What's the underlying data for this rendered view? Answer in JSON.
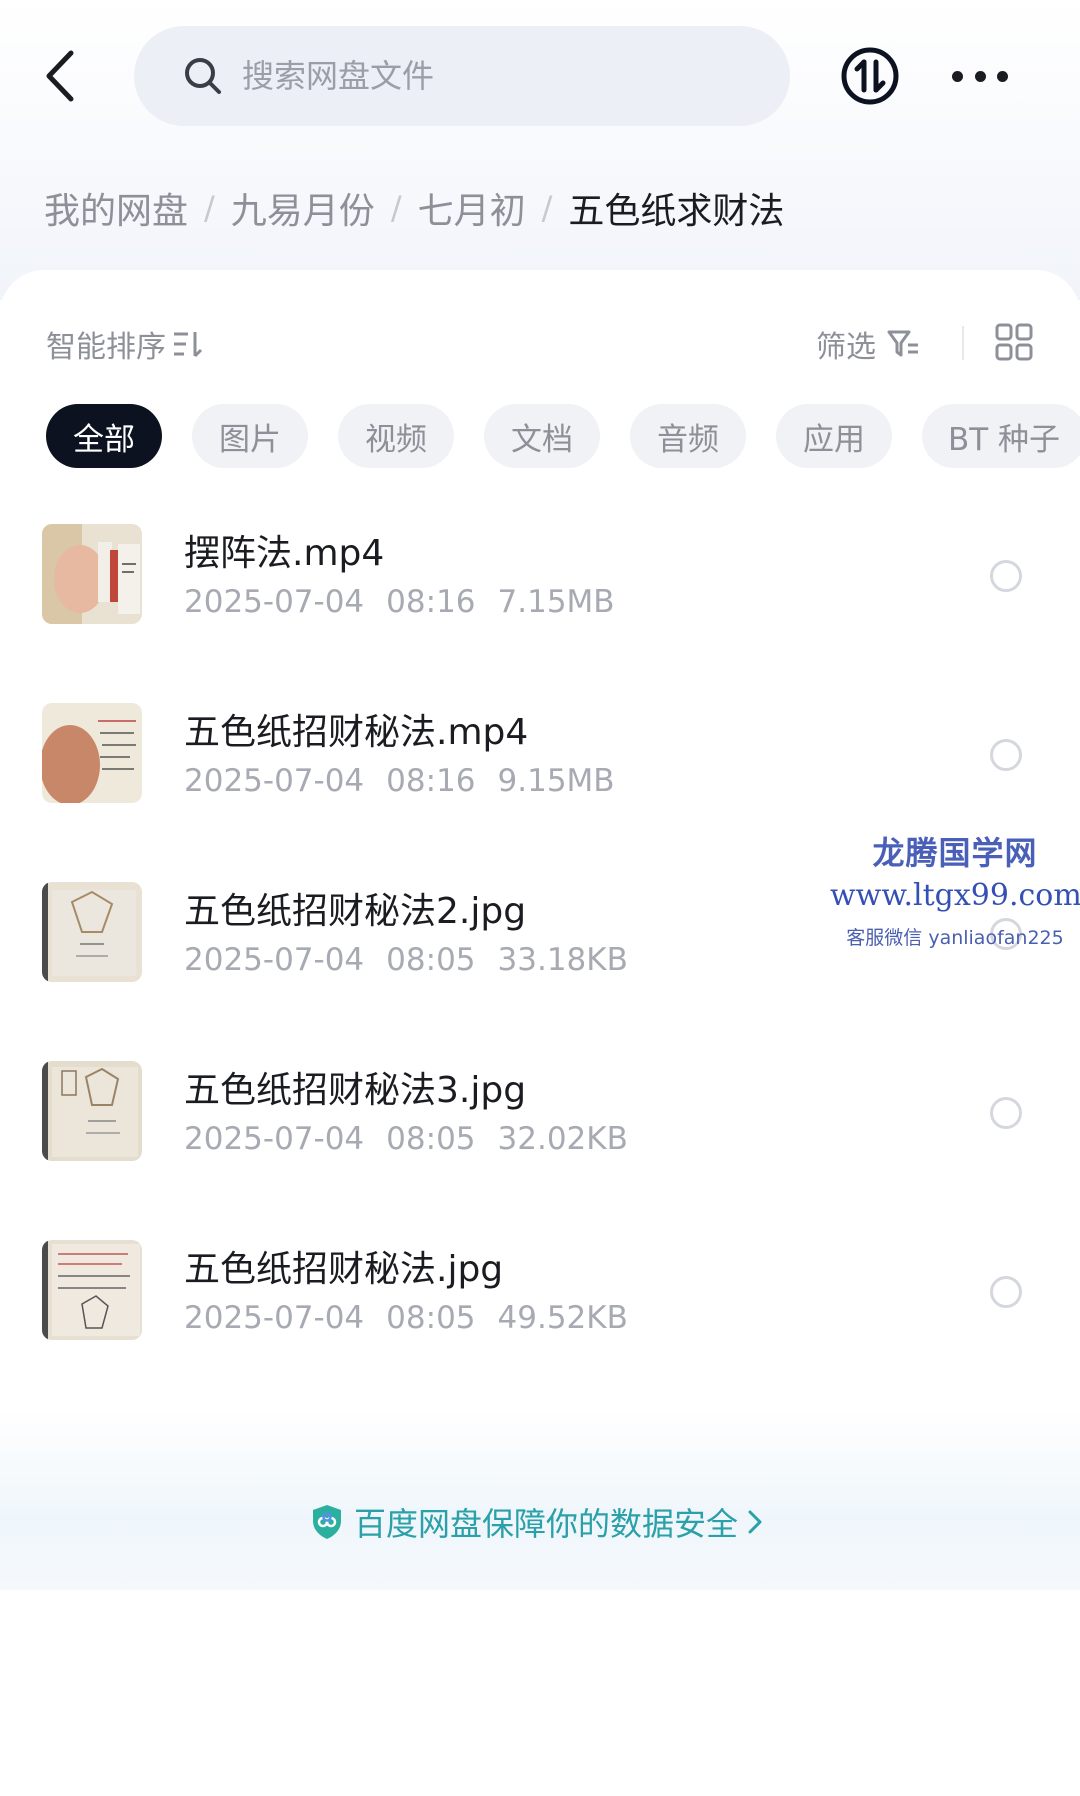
{
  "search": {
    "placeholder": "搜索网盘文件"
  },
  "breadcrumb": [
    {
      "label": "我的网盘"
    },
    {
      "label": "九易月份"
    },
    {
      "label": "七月初"
    },
    {
      "label": "五色纸求财法"
    }
  ],
  "toolbar": {
    "sort_label": "智能排序",
    "filter_label": "筛选"
  },
  "tabs": [
    {
      "label": "全部",
      "active": true
    },
    {
      "label": "图片"
    },
    {
      "label": "视频"
    },
    {
      "label": "文档"
    },
    {
      "label": "音频"
    },
    {
      "label": "应用"
    },
    {
      "label": "BT 种子"
    }
  ],
  "files": [
    {
      "name": "摆阵法.mp4",
      "date": "2025-07-04",
      "time": "08:16",
      "size": "7.15MB"
    },
    {
      "name": "五色纸招财秘法.mp4",
      "date": "2025-07-04",
      "time": "08:16",
      "size": "9.15MB"
    },
    {
      "name": "五色纸招财秘法2.jpg",
      "date": "2025-07-04",
      "time": "08:05",
      "size": "33.18KB"
    },
    {
      "name": "五色纸招财秘法3.jpg",
      "date": "2025-07-04",
      "time": "08:05",
      "size": "32.02KB"
    },
    {
      "name": "五色纸招财秘法.jpg",
      "date": "2025-07-04",
      "time": "08:05",
      "size": "49.52KB"
    }
  ],
  "watermark": {
    "title": "龙腾国学网",
    "url": "www.ltgx99.com",
    "contact": "客服微信 yanliaofan225"
  },
  "security_banner": {
    "label": "百度网盘保障你的数据安全"
  },
  "colors": {
    "accent_dark": "#0d1220",
    "security_teal": "#2aa0a8",
    "muted_text": "#8d9099"
  }
}
